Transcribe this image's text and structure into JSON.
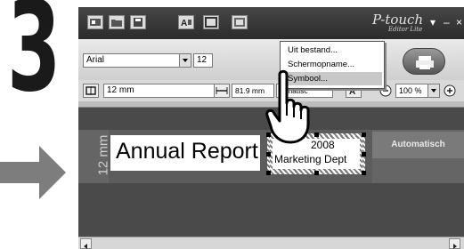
{
  "step": {
    "number": "3"
  },
  "app": {
    "logo_main": "P-touch",
    "logo_sub": "Editor Lite",
    "window_controls": [
      "▾",
      "–",
      "×"
    ]
  },
  "toolbar": {
    "font_name": "Arial",
    "font_size_partial": "12",
    "tape_width": "12 mm",
    "length_value": "81.9 mm",
    "length_mode_partial": "tomatisc",
    "zoom": "100 %",
    "buttons": [
      "A",
      "A",
      "A"
    ]
  },
  "menu": {
    "items": [
      {
        "label": "Uit bestand...",
        "highlighted": false
      },
      {
        "label": "Schermopname...",
        "highlighted": false
      },
      {
        "label": "Symbool...",
        "highlighted": true
      }
    ]
  },
  "canvas": {
    "tape_length_label": "12 mm",
    "label_text": "Annual Report",
    "selected_year": "2008",
    "selected_dept": "Marketing Dept",
    "auto_label": "Automatisch"
  },
  "icons": [
    "insert-image-icon",
    "open-folder-icon",
    "save-icon",
    "text-icon",
    "frame-icon",
    "image-icon",
    "print-icon",
    "pointing-hand-icon",
    "right-arrow-icon"
  ]
}
